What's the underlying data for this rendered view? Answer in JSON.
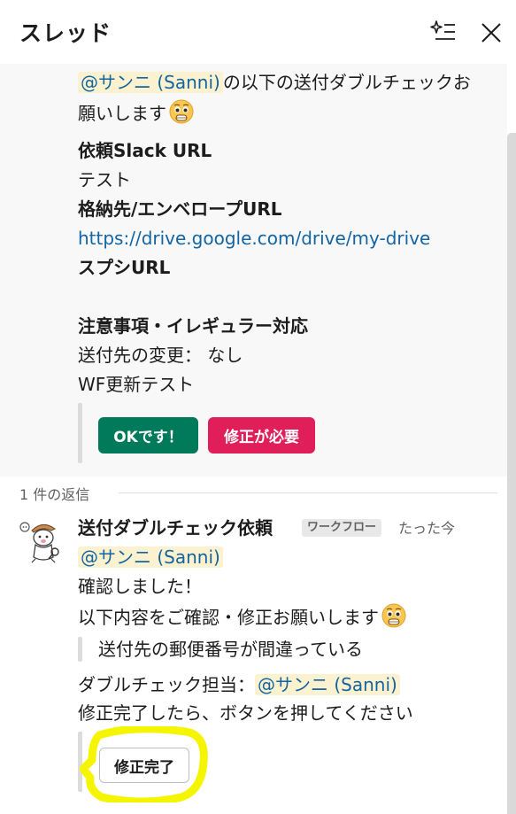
{
  "header": {
    "title": "スレッド"
  },
  "parent": {
    "mention": "@サンニ (Sanni)",
    "line1_text": "の以下の送付ダブルチェックお",
    "line2_text": "願いします",
    "request_label": "依頼Slack URL",
    "request_value": "テスト",
    "storage_label": "格納先/エンベロープURL",
    "storage_link": "https://drive.google.com/drive/my-drive",
    "spreadsheet_label": "スプシURL",
    "notes_label": "注意事項・イレギュラー対応",
    "notes_line1": "送付先の変更： なし",
    "notes_line2": "WF更新テスト",
    "ok_button": "OKです！",
    "fix_button": "修正が必要",
    "ok_color": "#007a5a",
    "fix_color": "#e01e5a"
  },
  "replies": {
    "count_label": "1 件の返信"
  },
  "reply": {
    "sender": "送付ダブルチェック依頼",
    "badge": "ワークフロー",
    "timestamp": "たった今",
    "mention": "@サンニ (Sanni)",
    "line1": "確認しました！",
    "line2": "以下内容をご確認・修正お願いします",
    "quote": "送付先の郵便番号が間違っている",
    "checker_label": "ダブルチェック担当：",
    "checker_mention": "@サンニ (Sanni)",
    "instruction": "修正完了したら、ボタンを押してください",
    "done_button": "修正完了"
  },
  "icons": {
    "ai": "ai-sparkle-list-icon",
    "close": "close-icon",
    "emoji": "pleading-face-emoji",
    "avatar": "workflow-bot-avatar"
  },
  "colors": {
    "mention_bg": "#fcf2cf",
    "link": "#1264a3",
    "highlight": "#f5f500"
  }
}
